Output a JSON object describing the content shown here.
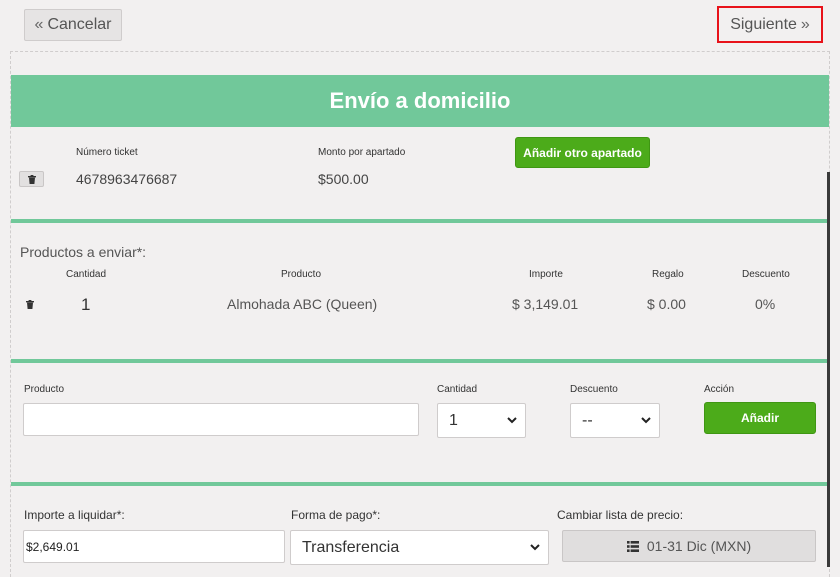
{
  "nav": {
    "cancel_label": "Cancelar",
    "next_label": "Siguiente"
  },
  "header": {
    "title": "Envío a domicilio"
  },
  "apartado": {
    "ticket_label": "Número ticket",
    "ticket_value": "4678963476687",
    "monto_label": "Monto por apartado",
    "monto_value": "$500.00",
    "add_label": "Añadir otro apartado"
  },
  "productos": {
    "section_label": "Productos a enviar*:",
    "columns": {
      "cantidad": "Cantidad",
      "producto": "Producto",
      "importe": "Importe",
      "regalo": "Regalo",
      "descuento": "Descuento"
    },
    "rows": [
      {
        "cantidad": "1",
        "producto": "Almohada ABC (Queen)",
        "importe": "$ 3,149.01",
        "regalo": "$ 0.00",
        "descuento": "0%"
      }
    ]
  },
  "add_form": {
    "producto_label": "Producto",
    "producto_value": "",
    "cantidad_label": "Cantidad",
    "cantidad_value": "1",
    "descuento_label": "Descuento",
    "descuento_value": "--",
    "accion_label": "Acción",
    "add_label": "Añadir"
  },
  "pago": {
    "importe_label": "Importe a liquidar*:",
    "importe_value": "$2,649.01",
    "forma_label": "Forma de pago*:",
    "forma_value": "Transferencia",
    "lista_label": "Cambiar lista de precio:",
    "lista_value": "01-31 Dic (MXN)"
  },
  "colors": {
    "accent_green": "#71c89a",
    "button_green": "#4cab1a",
    "highlight_red": "#e8121a"
  }
}
